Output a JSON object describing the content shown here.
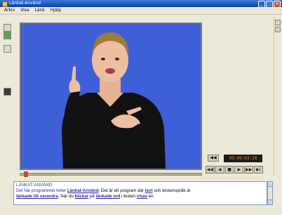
{
  "window": {
    "title": "Länkat-Använd",
    "controls": [
      "_",
      "□",
      "×"
    ]
  },
  "menu": {
    "items": [
      "Arkiv",
      "Visa",
      "Länk",
      "Hjälp"
    ]
  },
  "player": {
    "time_display": "00:00:03:20",
    "top_button_label": "◀◀",
    "second_button_label": "◀",
    "controls": [
      "◀◀",
      "◀",
      "■",
      "▶",
      "▶▶",
      "▶|"
    ],
    "seek_position": 0.02
  },
  "text_panel": {
    "heading": "LÄNKAT-ANVÄND",
    "line1_text1": "Det här programmet heter ",
    "line1_link1": "Länkat-Använd",
    "line1_text2": ". Det är ett program där ",
    "line1_link2": "text",
    "line1_text3": " och teckenspråk är",
    "line2_link1": "länkade till varandra",
    "line2_text1": ". När du ",
    "line2_link2": "klickar",
    "line2_text2": " på ",
    "line2_link3": "länkade ord",
    "line2_text3": " i texten ",
    "line2_link4": "visas",
    "line2_text4": " en"
  },
  "colors": {
    "video_background": "#3f5fd8",
    "link_color": "#2a2ab0",
    "titlebar": "#0a3fa6"
  },
  "icons": {
    "left_tools": [
      "folder-icon",
      "flag-icon",
      "settings-icon",
      "hand-icon"
    ],
    "scroll": [
      "scroll-up-icon",
      "scroll-down-icon"
    ]
  }
}
